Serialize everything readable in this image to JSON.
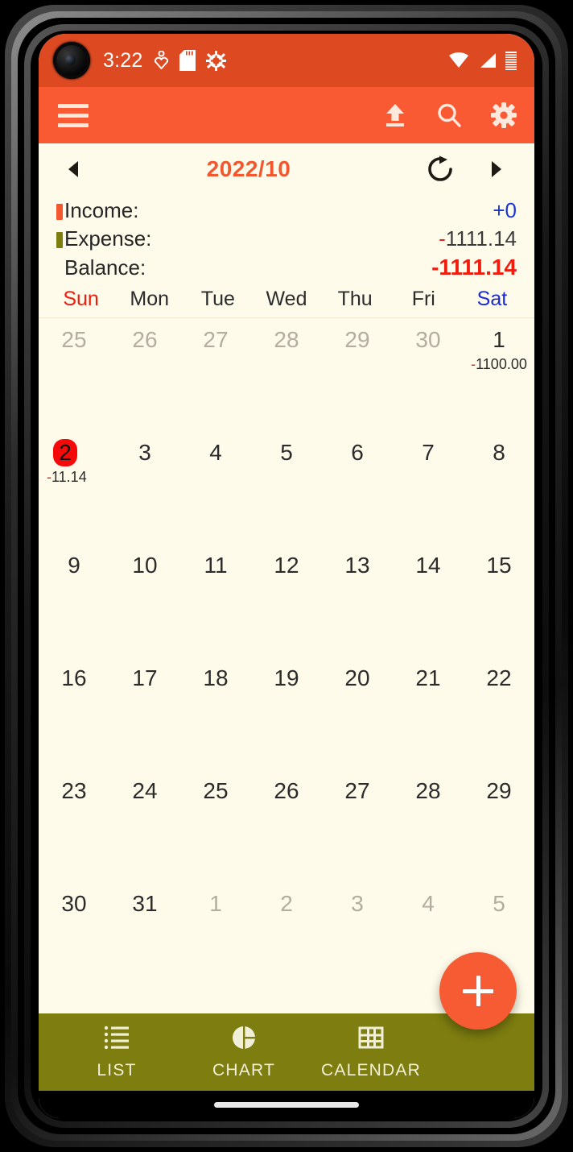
{
  "status_bar": {
    "time": "3:22",
    "icons_left": [
      "heart-pulse-icon",
      "sd-card-icon",
      "android-gear-icon"
    ],
    "icons_right": [
      "wifi-icon",
      "cellular-signal-icon",
      "battery-icon"
    ]
  },
  "toolbar": {
    "menu_icon": "hamburger-menu-icon",
    "actions": [
      {
        "name": "export-icon",
        "label": "Export"
      },
      {
        "name": "search-icon",
        "label": "Search"
      },
      {
        "name": "settings-icon",
        "label": "Settings"
      }
    ]
  },
  "month_nav": {
    "prev_label": "◀",
    "next_label": "▶",
    "month_label": "2022/10",
    "refresh_icon": "refresh-icon"
  },
  "summary": {
    "income": {
      "label": "Income:",
      "value": "+0",
      "marker_color": "#F2572F"
    },
    "expense": {
      "label": "Expense:",
      "sign": "-",
      "value": "1111.14",
      "marker_color": "#7D7D10"
    },
    "balance": {
      "label": "Balance:",
      "sign": "-",
      "value": "1111.14"
    }
  },
  "weekdays": [
    {
      "label": "Sun",
      "kind": "sun"
    },
    {
      "label": "Mon",
      "kind": "day"
    },
    {
      "label": "Tue",
      "kind": "day"
    },
    {
      "label": "Wed",
      "kind": "day"
    },
    {
      "label": "Thu",
      "kind": "day"
    },
    {
      "label": "Fri",
      "kind": "day"
    },
    {
      "label": "Sat",
      "kind": "sat"
    }
  ],
  "calendar": {
    "days": [
      {
        "n": "25",
        "muted": true,
        "today": false,
        "sign": "",
        "amount": ""
      },
      {
        "n": "26",
        "muted": true,
        "today": false,
        "sign": "",
        "amount": ""
      },
      {
        "n": "27",
        "muted": true,
        "today": false,
        "sign": "",
        "amount": ""
      },
      {
        "n": "28",
        "muted": true,
        "today": false,
        "sign": "",
        "amount": ""
      },
      {
        "n": "29",
        "muted": true,
        "today": false,
        "sign": "",
        "amount": ""
      },
      {
        "n": "30",
        "muted": true,
        "today": false,
        "sign": "",
        "amount": ""
      },
      {
        "n": "1",
        "muted": false,
        "today": false,
        "sign": "-",
        "amount": "1100.00"
      },
      {
        "n": "2",
        "muted": false,
        "today": true,
        "sign": "-",
        "amount": "11.14"
      },
      {
        "n": "3",
        "muted": false,
        "today": false,
        "sign": "",
        "amount": ""
      },
      {
        "n": "4",
        "muted": false,
        "today": false,
        "sign": "",
        "amount": ""
      },
      {
        "n": "5",
        "muted": false,
        "today": false,
        "sign": "",
        "amount": ""
      },
      {
        "n": "6",
        "muted": false,
        "today": false,
        "sign": "",
        "amount": ""
      },
      {
        "n": "7",
        "muted": false,
        "today": false,
        "sign": "",
        "amount": ""
      },
      {
        "n": "8",
        "muted": false,
        "today": false,
        "sign": "",
        "amount": ""
      },
      {
        "n": "9",
        "muted": false,
        "today": false,
        "sign": "",
        "amount": ""
      },
      {
        "n": "10",
        "muted": false,
        "today": false,
        "sign": "",
        "amount": ""
      },
      {
        "n": "11",
        "muted": false,
        "today": false,
        "sign": "",
        "amount": ""
      },
      {
        "n": "12",
        "muted": false,
        "today": false,
        "sign": "",
        "amount": ""
      },
      {
        "n": "13",
        "muted": false,
        "today": false,
        "sign": "",
        "amount": ""
      },
      {
        "n": "14",
        "muted": false,
        "today": false,
        "sign": "",
        "amount": ""
      },
      {
        "n": "15",
        "muted": false,
        "today": false,
        "sign": "",
        "amount": ""
      },
      {
        "n": "16",
        "muted": false,
        "today": false,
        "sign": "",
        "amount": ""
      },
      {
        "n": "17",
        "muted": false,
        "today": false,
        "sign": "",
        "amount": ""
      },
      {
        "n": "18",
        "muted": false,
        "today": false,
        "sign": "",
        "amount": ""
      },
      {
        "n": "19",
        "muted": false,
        "today": false,
        "sign": "",
        "amount": ""
      },
      {
        "n": "20",
        "muted": false,
        "today": false,
        "sign": "",
        "amount": ""
      },
      {
        "n": "21",
        "muted": false,
        "today": false,
        "sign": "",
        "amount": ""
      },
      {
        "n": "22",
        "muted": false,
        "today": false,
        "sign": "",
        "amount": ""
      },
      {
        "n": "23",
        "muted": false,
        "today": false,
        "sign": "",
        "amount": ""
      },
      {
        "n": "24",
        "muted": false,
        "today": false,
        "sign": "",
        "amount": ""
      },
      {
        "n": "25",
        "muted": false,
        "today": false,
        "sign": "",
        "amount": ""
      },
      {
        "n": "26",
        "muted": false,
        "today": false,
        "sign": "",
        "amount": ""
      },
      {
        "n": "27",
        "muted": false,
        "today": false,
        "sign": "",
        "amount": ""
      },
      {
        "n": "28",
        "muted": false,
        "today": false,
        "sign": "",
        "amount": ""
      },
      {
        "n": "29",
        "muted": false,
        "today": false,
        "sign": "",
        "amount": ""
      },
      {
        "n": "30",
        "muted": false,
        "today": false,
        "sign": "",
        "amount": ""
      },
      {
        "n": "31",
        "muted": false,
        "today": false,
        "sign": "",
        "amount": ""
      },
      {
        "n": "1",
        "muted": true,
        "today": false,
        "sign": "",
        "amount": ""
      },
      {
        "n": "2",
        "muted": true,
        "today": false,
        "sign": "",
        "amount": ""
      },
      {
        "n": "3",
        "muted": true,
        "today": false,
        "sign": "",
        "amount": ""
      },
      {
        "n": "4",
        "muted": true,
        "today": false,
        "sign": "",
        "amount": ""
      },
      {
        "n": "5",
        "muted": true,
        "today": false,
        "sign": "",
        "amount": ""
      }
    ]
  },
  "fab": {
    "icon": "plus-icon",
    "label": "Add"
  },
  "bottom_nav": {
    "tabs": [
      {
        "label": "LIST",
        "icon": "list-icon"
      },
      {
        "label": "CHART",
        "icon": "pie-chart-icon"
      },
      {
        "label": "CALENDAR",
        "icon": "calendar-grid-icon"
      }
    ]
  },
  "colors": {
    "status_bar": "#DD4A22",
    "toolbar": "#F95A33",
    "background": "#FFFBEB",
    "accent_orange": "#F2572F",
    "bottom_nav": "#7D7D10",
    "negative_red": "#F01D0E",
    "positive_blue": "#1a35D6",
    "today_highlight": "#F50A0A"
  }
}
